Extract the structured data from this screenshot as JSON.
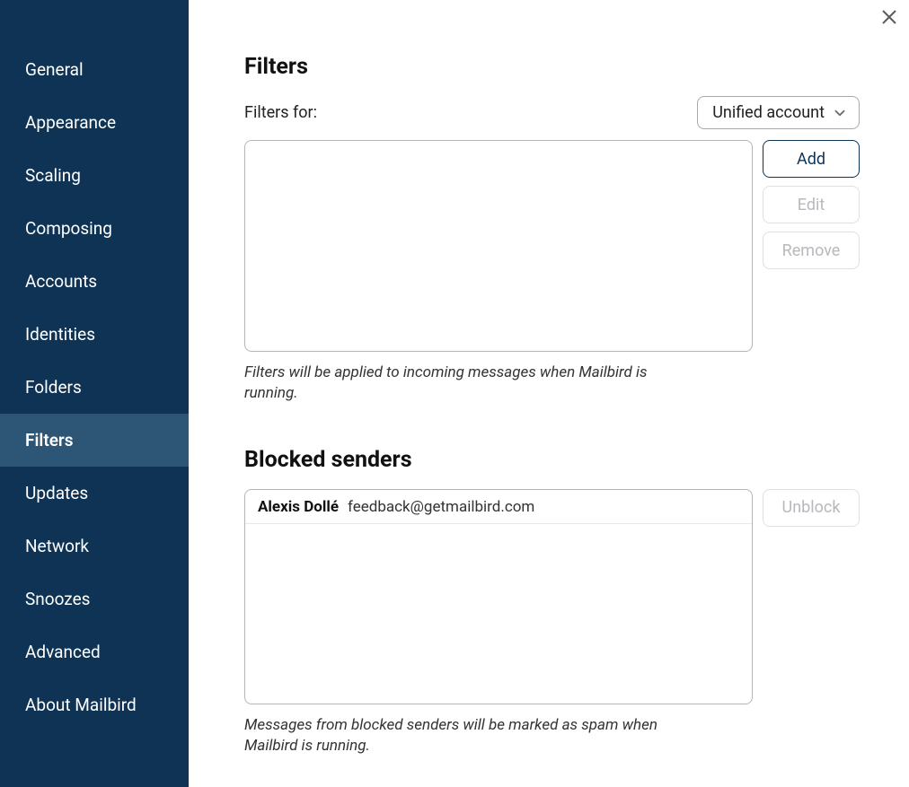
{
  "sidebar": {
    "items": [
      {
        "label": "General",
        "active": false
      },
      {
        "label": "Appearance",
        "active": false
      },
      {
        "label": "Scaling",
        "active": false
      },
      {
        "label": "Composing",
        "active": false
      },
      {
        "label": "Accounts",
        "active": false
      },
      {
        "label": "Identities",
        "active": false
      },
      {
        "label": "Folders",
        "active": false
      },
      {
        "label": "Filters",
        "active": true
      },
      {
        "label": "Updates",
        "active": false
      },
      {
        "label": "Network",
        "active": false
      },
      {
        "label": "Snoozes",
        "active": false
      },
      {
        "label": "Advanced",
        "active": false
      },
      {
        "label": "About Mailbird",
        "active": false
      }
    ]
  },
  "filters": {
    "heading": "Filters",
    "for_label": "Filters for:",
    "dropdown_selected": "Unified account",
    "buttons": {
      "add": "Add",
      "edit": "Edit",
      "remove": "Remove"
    },
    "note": "Filters will be applied to incoming messages when Mailbird is running."
  },
  "blocked": {
    "heading": "Blocked senders",
    "items": [
      {
        "name": "Alexis Dollé",
        "email": "feedback@getmailbird.com"
      }
    ],
    "buttons": {
      "unblock": "Unblock"
    },
    "note": "Messages from blocked senders will be marked as spam when Mailbird is running."
  }
}
